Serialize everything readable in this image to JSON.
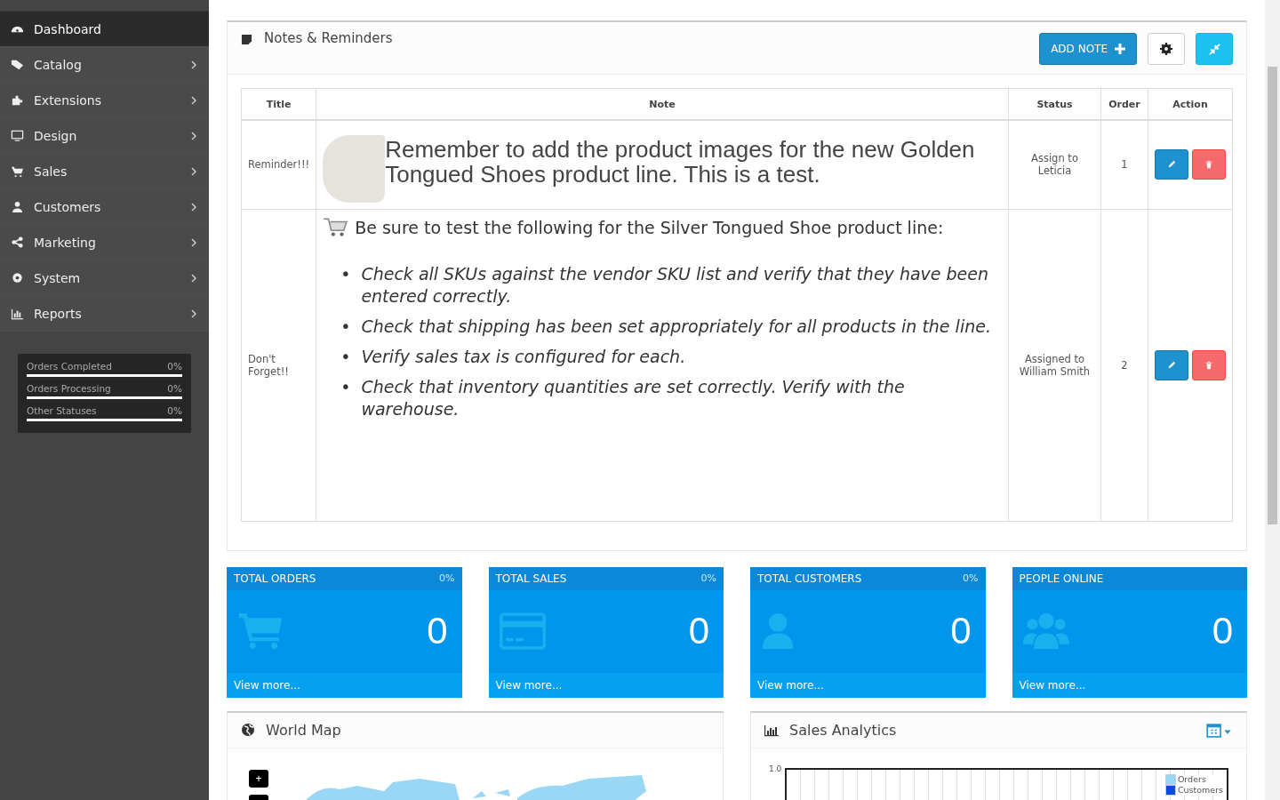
{
  "sidebar": {
    "items": [
      {
        "label": "Dashboard",
        "selected": true
      },
      {
        "label": "Catalog",
        "selected": false
      },
      {
        "label": "Extensions",
        "selected": false
      },
      {
        "label": "Design",
        "selected": false
      },
      {
        "label": "Sales",
        "selected": false
      },
      {
        "label": "Customers",
        "selected": false
      },
      {
        "label": "Marketing",
        "selected": false
      },
      {
        "label": "System",
        "selected": false
      },
      {
        "label": "Reports",
        "selected": false
      }
    ],
    "statuses": [
      {
        "label": "Orders Completed",
        "reading": "0%",
        "level": 0
      },
      {
        "label": "Orders Processing",
        "reading": "0%",
        "level": 0
      },
      {
        "label": "Other Statuses",
        "reading": "0%",
        "level": 0
      }
    ]
  },
  "notes": {
    "title": "Notes & Reminders",
    "add_button": "ADD NOTE",
    "columns": [
      "Title",
      "Note",
      "Status",
      "Order",
      "Action"
    ],
    "rows": [
      {
        "title": "Reminder!!!",
        "kind": "image",
        "text": "Remember to add the product images for the new Golden Tongued Shoes product line. This is a test.",
        "status": "Assign to Leticia",
        "order": "1"
      },
      {
        "title": "Don't Forget!!",
        "kind": "list",
        "text": "Be sure to test the following for the Silver Tongued Shoe product line:",
        "marker": "•",
        "bullets": [
          "Check all SKUs against the vendor SKU list and verify that they have been entered correctly.",
          "Check that shipping has been set appropriately for all products in the line.",
          "Verify sales tax is configured for each.",
          "Check that inventory quantities are set correctly. Verify with the warehouse."
        ],
        "status": "Assigned to William Smith",
        "order": "2"
      }
    ]
  },
  "tiles": [
    {
      "title": "TOTAL ORDERS",
      "percent": "0%",
      "value": "0",
      "link": "View more..."
    },
    {
      "title": "TOTAL SALES",
      "percent": "0%",
      "value": "0",
      "link": "View more..."
    },
    {
      "title": "TOTAL CUSTOMERS",
      "percent": "0%",
      "value": "0",
      "link": "View more..."
    },
    {
      "title": "PEOPLE ONLINE",
      "value": "0",
      "link": "View more..."
    }
  ],
  "world_map": {
    "title": "World Map",
    "zoom_in": "+"
  },
  "sales_analytics": {
    "title": "Sales Analytics",
    "y_tick": "1.0",
    "legend": [
      {
        "label": "Orders",
        "color": "#9ad7f7"
      },
      {
        "label": "Customers",
        "color": "#0a4ddb"
      }
    ]
  }
}
